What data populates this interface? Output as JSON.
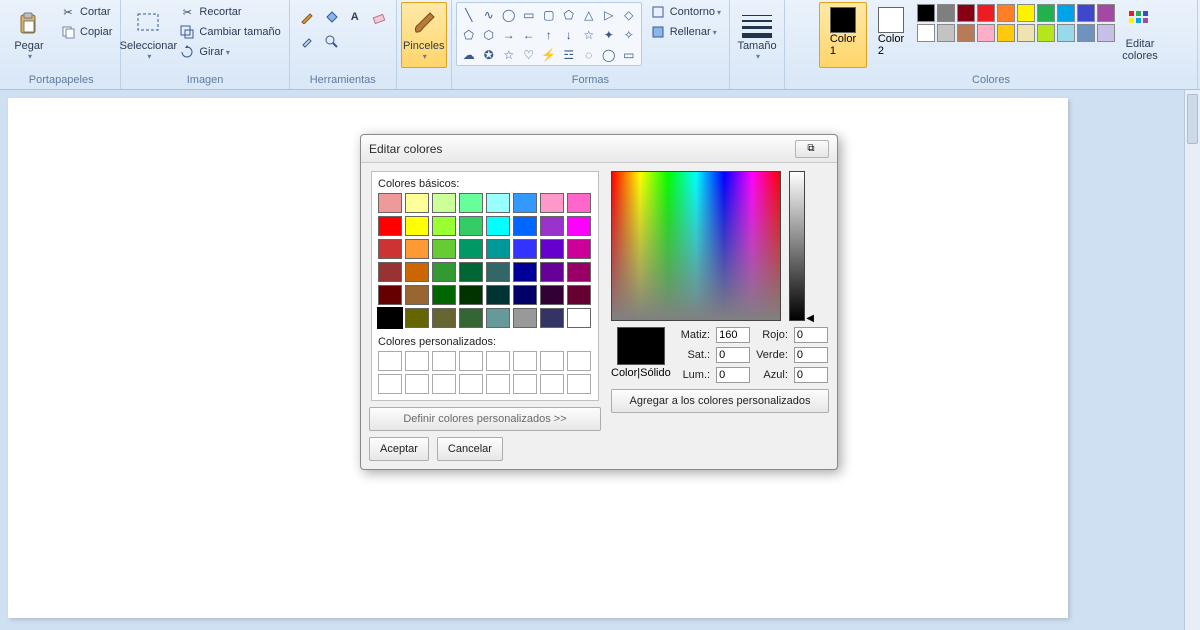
{
  "ribbon": {
    "clipboard": {
      "paste": "Pegar",
      "cut": "Cortar",
      "copy": "Copiar",
      "group": "Portapapeles"
    },
    "image": {
      "select": "Seleccionar",
      "crop": "Recortar",
      "resize": "Cambiar tamaño",
      "rotate": "Girar",
      "group": "Imagen"
    },
    "tools": {
      "group": "Herramientas"
    },
    "brushes": {
      "label": "Pinceles"
    },
    "shapes": {
      "outline": "Contorno",
      "fill": "Rellenar",
      "group": "Formas"
    },
    "size": {
      "label": "Tamaño"
    },
    "colors": {
      "color1": "Color\n1",
      "color2": "Color\n2",
      "group": "Colores",
      "edit": "Editar\ncolores",
      "color1_value": "#000000",
      "color2_value": "#ffffff",
      "palette_row1": [
        "#000000",
        "#7f7f7f",
        "#880015",
        "#ed1c24",
        "#ff7f27",
        "#fff200",
        "#22b14c",
        "#00a2e8",
        "#3f48cc",
        "#a349a4"
      ],
      "palette_row2": [
        "#ffffff",
        "#c3c3c3",
        "#b97a57",
        "#ffaec9",
        "#ffc90e",
        "#efe4b0",
        "#b5e61d",
        "#99d9ea",
        "#7092be",
        "#c8bfe7"
      ]
    }
  },
  "dialog": {
    "title": "Editar colores",
    "basic_label": "Colores básicos:",
    "basic_colors": [
      [
        "#ef9a9a",
        "#ffff99",
        "#ccff99",
        "#66ff99",
        "#99ffff",
        "#3399ff",
        "#ff99cc",
        "#ff66cc"
      ],
      [
        "#ff0000",
        "#ffff00",
        "#99ff33",
        "#33cc66",
        "#00ffff",
        "#0066ff",
        "#9933cc",
        "#ff00ff"
      ],
      [
        "#cc3333",
        "#ff9933",
        "#66cc33",
        "#009966",
        "#009999",
        "#3333ff",
        "#6600cc",
        "#cc0099"
      ],
      [
        "#993333",
        "#cc6600",
        "#339933",
        "#006633",
        "#336666",
        "#000099",
        "#660099",
        "#990066"
      ],
      [
        "#660000",
        "#996633",
        "#006600",
        "#003300",
        "#003333",
        "#000066",
        "#330033",
        "#660033"
      ],
      [
        "#000000",
        "#666600",
        "#666633",
        "#336633",
        "#669999",
        "#999999",
        "#333366",
        "#ffffff"
      ]
    ],
    "custom_label": "Colores personalizados:",
    "define_custom": "Definir colores personalizados >>",
    "ok": "Aceptar",
    "cancel": "Cancelar",
    "color_solid": "Color|Sólido",
    "hue_label": "Matiz:",
    "sat_label": "Sat.:",
    "lum_label": "Lum.:",
    "red_label": "Rojo:",
    "green_label": "Verde:",
    "blue_label": "Azul:",
    "hue": "160",
    "sat": "0",
    "lum": "0",
    "red": "0",
    "green": "0",
    "blue": "0",
    "preview_color": "#000000",
    "add_custom": "Agregar a los colores personalizados"
  }
}
